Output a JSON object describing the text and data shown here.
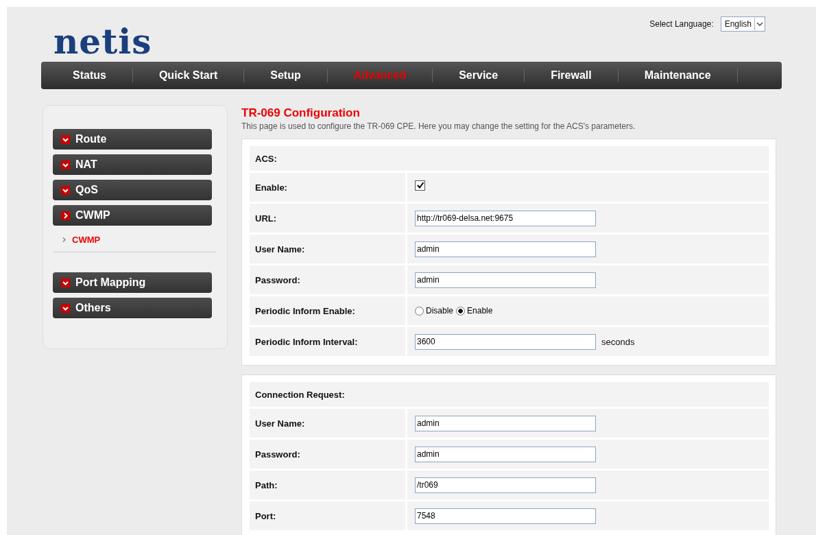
{
  "logo": "netis",
  "language": {
    "label": "Select Language:",
    "value": "English"
  },
  "nav": [
    {
      "label": "Status",
      "selected": false
    },
    {
      "label": "Quick Start",
      "selected": false
    },
    {
      "label": "Setup",
      "selected": false
    },
    {
      "label": "Advanced",
      "selected": true
    },
    {
      "label": "Service",
      "selected": false
    },
    {
      "label": "Firewall",
      "selected": false
    },
    {
      "label": "Maintenance",
      "selected": false
    }
  ],
  "sidebar": {
    "items": [
      {
        "label": "Route",
        "selected": false
      },
      {
        "label": "NAT",
        "selected": false
      },
      {
        "label": "QoS",
        "selected": false
      },
      {
        "label": "CWMP",
        "selected": true,
        "children": [
          {
            "label": "CWMP",
            "selected": true
          }
        ]
      },
      {
        "label": "Port Mapping",
        "selected": false
      },
      {
        "label": "Others",
        "selected": false
      }
    ]
  },
  "page": {
    "title": "TR-069 Configuration",
    "description": "This page is used to configure the TR-069 CPE. Here you may change the setting for the ACS's parameters."
  },
  "sections": [
    {
      "heading": "ACS:",
      "rows": [
        {
          "kind": "checkbox",
          "label": "Enable:",
          "checked": true
        },
        {
          "kind": "text",
          "label": "URL:",
          "value": "http://tr069-delsa.net:9675"
        },
        {
          "kind": "text",
          "label": "User Name:",
          "value": "admin"
        },
        {
          "kind": "text",
          "label": "Password:",
          "value": "admin"
        },
        {
          "kind": "radio",
          "label": "Periodic Inform Enable:",
          "options": [
            {
              "label": "Disable",
              "selected": false
            },
            {
              "label": "Enable",
              "selected": true
            }
          ]
        },
        {
          "kind": "text",
          "label": "Periodic Inform Interval:",
          "value": "3600",
          "unit": "seconds"
        }
      ]
    },
    {
      "heading": "Connection Request:",
      "rows": [
        {
          "kind": "text",
          "label": "User Name:",
          "value": "admin"
        },
        {
          "kind": "text",
          "label": "Password:",
          "value": "admin"
        },
        {
          "kind": "text",
          "label": "Path:",
          "value": "/tr069"
        },
        {
          "kind": "text",
          "label": "Port:",
          "value": "7548"
        }
      ]
    }
  ]
}
